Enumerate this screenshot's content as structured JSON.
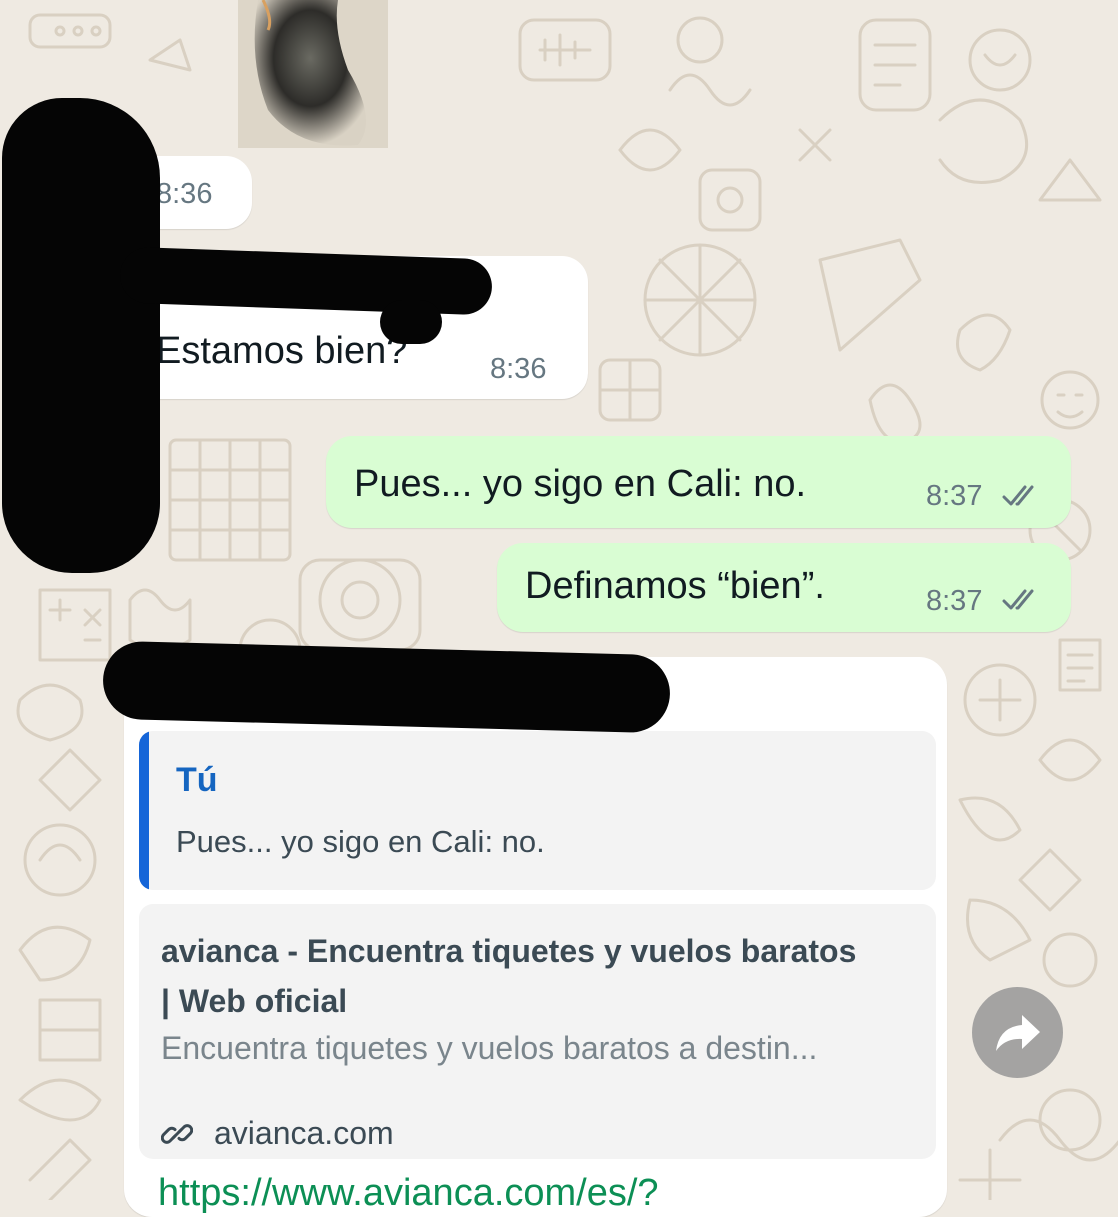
{
  "messages": [
    {
      "time": "8:36"
    },
    {
      "text": "Estamos bien?",
      "time": "8:36"
    },
    {
      "text": "Pues... yo sigo en Cali: no.",
      "time": "8:37",
      "status": "read"
    },
    {
      "text": "Definamos “bien”.",
      "time": "8:37",
      "status": "read"
    }
  ],
  "reply_message": {
    "quote": {
      "author": "Tú",
      "text": "Pues... yo sigo en Cali: no."
    },
    "link_preview": {
      "title": "avianca - Encuentra tiquetes y vuelos baratos | Web oficial",
      "description": "Encuentra tiquetes y vuelos baratos a destin...",
      "domain": "avianca.com"
    },
    "url_text": "https://www.avianca.com/es/?"
  },
  "icons": {
    "forward": "forward-arrow-icon",
    "link": "link-icon",
    "read_receipt": "double-check-icon"
  },
  "colors": {
    "chat_background": "#efeae2",
    "incoming_bubble": "#ffffff",
    "outgoing_bubble": "#d9fdd3",
    "quote_bar": "#1565d8",
    "link_green": "#0c8f55"
  }
}
